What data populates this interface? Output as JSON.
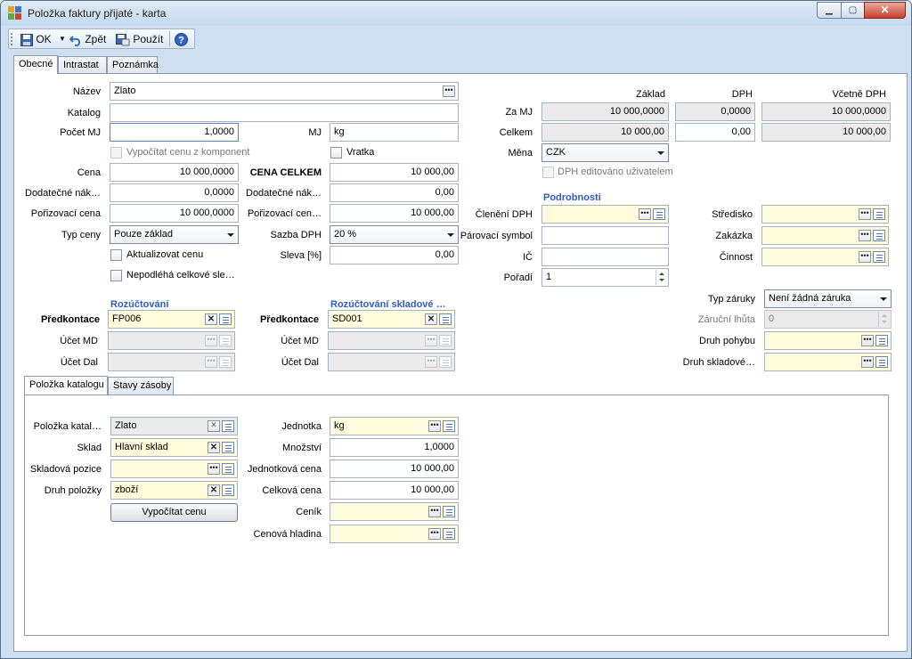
{
  "window": {
    "title": "Položka faktury přijaté - karta"
  },
  "toolbar": {
    "ok": "OK",
    "back": "Zpět",
    "apply": "Použít"
  },
  "tabs": [
    "Obecné",
    "Intrastat",
    "Poznámka"
  ],
  "left": {
    "nazev_label": "Název",
    "nazev_value": "Zlato",
    "katalog_label": "Katalog",
    "katalog_value": "",
    "pocet_mj_label": "Počet MJ",
    "pocet_mj_value": "1,0000",
    "mj_label": "MJ",
    "mj_value": "kg",
    "vypocitat_label": "Vypočítat cenu z komponent",
    "vratka_label": "Vratka",
    "cena_label": "Cena",
    "cena_value": "10 000,0000",
    "cena_celkem_label": "CENA CELKEM",
    "cena_celkem_value": "10 000,00",
    "dodatecne_label": "Dodatečné nák…",
    "dodatecne_value": "0,0000",
    "dodatecne2_label": "Dodatečné nák…",
    "dodatecne2_value": "0,00",
    "porizovaci_label": "Pořizovací cena",
    "porizovaci_value": "10 000,0000",
    "porizovaci2_label": "Pořizovací cen…",
    "porizovaci2_value": "10 000,00",
    "typ_ceny_label": "Typ ceny",
    "typ_ceny_value": "Pouze základ",
    "sazba_label": "Sazba DPH",
    "sazba_value": "20 %",
    "aktualizovat_label": "Aktualizovat cenu",
    "sleva_label": "Sleva [%]",
    "sleva_value": "0,00",
    "nepodleha_label": "Nepodléhá celkové sle…"
  },
  "right": {
    "col_zaklad": "Základ",
    "col_dph": "DPH",
    "col_vcetne": "Včetně DPH",
    "za_mj_label": "Za MJ",
    "za_mj_zaklad": "10 000,0000",
    "za_mj_dph": "0,0000",
    "za_mj_vcetne": "10 000,0000",
    "celkem_label": "Celkem",
    "celkem_zaklad": "10 000,00",
    "celkem_dph": "0,00",
    "celkem_vcetne": "10 000,00",
    "mena_label": "Měna",
    "mena_value": "CZK",
    "dph_editovano_label": "DPH editováno uživatelem",
    "podrobnosti_label": "Podrobnosti",
    "cleneni_label": "Členění DPH",
    "cleneni_value": "",
    "parovaci_label": "Párovací symbol",
    "parovaci_value": "",
    "ic_label": "IČ",
    "ic_value": "",
    "poradi_label": "Pořadí",
    "poradi_value": "1",
    "stredisko_label": "Středisko",
    "stredisko_value": "",
    "zakazka_label": "Zakázka",
    "zakazka_value": "",
    "cinnost_label": "Činnost",
    "cinnost_value": "",
    "typ_zaruky_label": "Typ záruky",
    "typ_zaruky_value": "Není žádná záruka",
    "zarucni_lhuta_label": "Záruční lhůta",
    "zarucni_lhuta_value": "0",
    "druh_pohybu_label": "Druh pohybu",
    "druh_pohybu_value": "",
    "druh_skladove_label": "Druh skladové…",
    "druh_skladove_value": ""
  },
  "accounting": {
    "rozuctovani_label": "Rozúčtování",
    "rozuctovani_skladove_label": "Rozúčtování skladové …",
    "predkontace_label": "Předkontace",
    "predkontace_value": "FP006",
    "predkontace2_label": "Předkontace",
    "predkontace2_value": "SD001",
    "ucet_md_label": "Účet MD",
    "ucet_md2_label": "Účet MD",
    "ucet_dal_label": "Účet Dal",
    "ucet_dal2_label": "Účet Dal"
  },
  "inner_tabs": [
    "Položka katalogu",
    "Stavy zásoby"
  ],
  "catalog": {
    "polozka_label": "Položka katal…",
    "polozka_value": "Zlato",
    "sklad_label": "Sklad",
    "sklad_value": "Hlavní sklad",
    "pozice_label": "Skladová pozice",
    "pozice_value": "",
    "druh_label": "Druh položky",
    "druh_value": "zboží",
    "vypocitat_button": "Vypočítat cenu",
    "jednotka_label": "Jednotka",
    "jednotka_value": "kg",
    "mnozstvi_label": "Množství",
    "mnozstvi_value": "1,0000",
    "jednotkova_label": "Jednotková cena",
    "jednotkova_value": "10 000,00",
    "celkova_label": "Celková cena",
    "celkova_value": "10 000,00",
    "cenik_label": "Ceník",
    "cenik_value": "",
    "hladina_label": "Cenová hladina",
    "hladina_value": ""
  },
  "colors": {
    "section": "#2e5ccb",
    "required_field": "#fffbdc",
    "readonly_field": "#ebebeb"
  }
}
